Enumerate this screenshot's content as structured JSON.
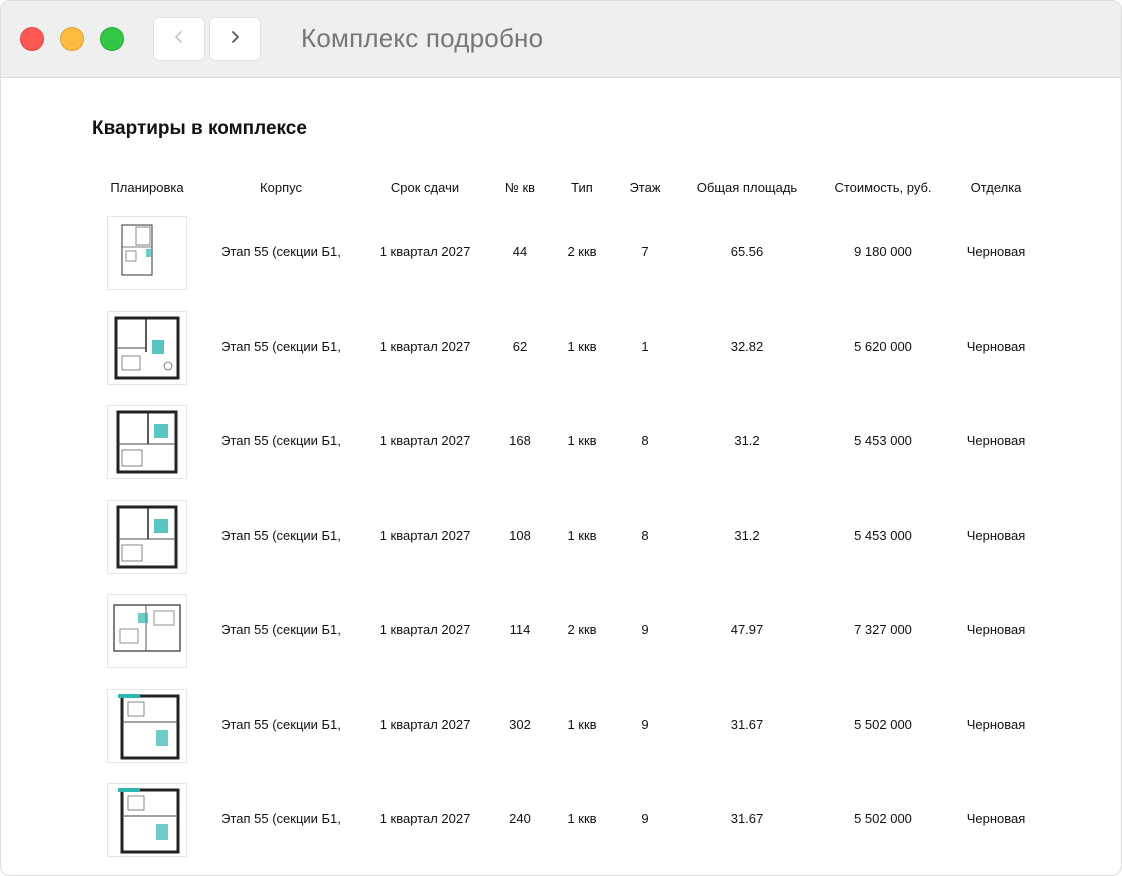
{
  "window": {
    "title": "Комплекс подробно"
  },
  "page": {
    "heading": "Квартиры в комплексе"
  },
  "table": {
    "headers": {
      "plan": "Планировка",
      "building": "Корпус",
      "deadline": "Срок сдачи",
      "number": "№ кв",
      "type": "Тип",
      "floor": "Этаж",
      "area": "Общая площадь",
      "price": "Стоимость, руб.",
      "finish": "Отделка"
    },
    "rows": [
      {
        "building": "Этап 55 (секции Б1,",
        "deadline": "1 квартал 2027",
        "number": "44",
        "type": "2 ккв",
        "floor": "7",
        "area": "65.56",
        "price": "9 180 000",
        "finish": "Черновая"
      },
      {
        "building": "Этап 55 (секции Б1,",
        "deadline": "1 квартал 2027",
        "number": "62",
        "type": "1 ккв",
        "floor": "1",
        "area": "32.82",
        "price": "5 620 000",
        "finish": "Черновая"
      },
      {
        "building": "Этап 55 (секции Б1,",
        "deadline": "1 квартал 2027",
        "number": "168",
        "type": "1 ккв",
        "floor": "8",
        "area": "31.2",
        "price": "5 453 000",
        "finish": "Черновая"
      },
      {
        "building": "Этап 55 (секции Б1,",
        "deadline": "1 квартал 2027",
        "number": "108",
        "type": "1 ккв",
        "floor": "8",
        "area": "31.2",
        "price": "5 453 000",
        "finish": "Черновая"
      },
      {
        "building": "Этап 55 (секции Б1,",
        "deadline": "1 квартал 2027",
        "number": "114",
        "type": "2 ккв",
        "floor": "9",
        "area": "47.97",
        "price": "7 327 000",
        "finish": "Черновая"
      },
      {
        "building": "Этап 55 (секции Б1,",
        "deadline": "1 квартал 2027",
        "number": "302",
        "type": "1 ккв",
        "floor": "9",
        "area": "31.67",
        "price": "5 502 000",
        "finish": "Черновая"
      },
      {
        "building": "Этап 55 (секции Б1,",
        "deadline": "1 квартал 2027",
        "number": "240",
        "type": "1 ккв",
        "floor": "9",
        "area": "31.67",
        "price": "5 502 000",
        "finish": "Черновая"
      }
    ]
  },
  "icons": {
    "back": "chevron-left-icon",
    "forward": "chevron-right-icon",
    "plan": "floor-plan-thumbnail"
  },
  "colors": {
    "accent": "#2fb7b1",
    "titlebar": "#efefef",
    "close": "#fc5753",
    "minimize": "#fdbc40",
    "zoom": "#33c748"
  }
}
